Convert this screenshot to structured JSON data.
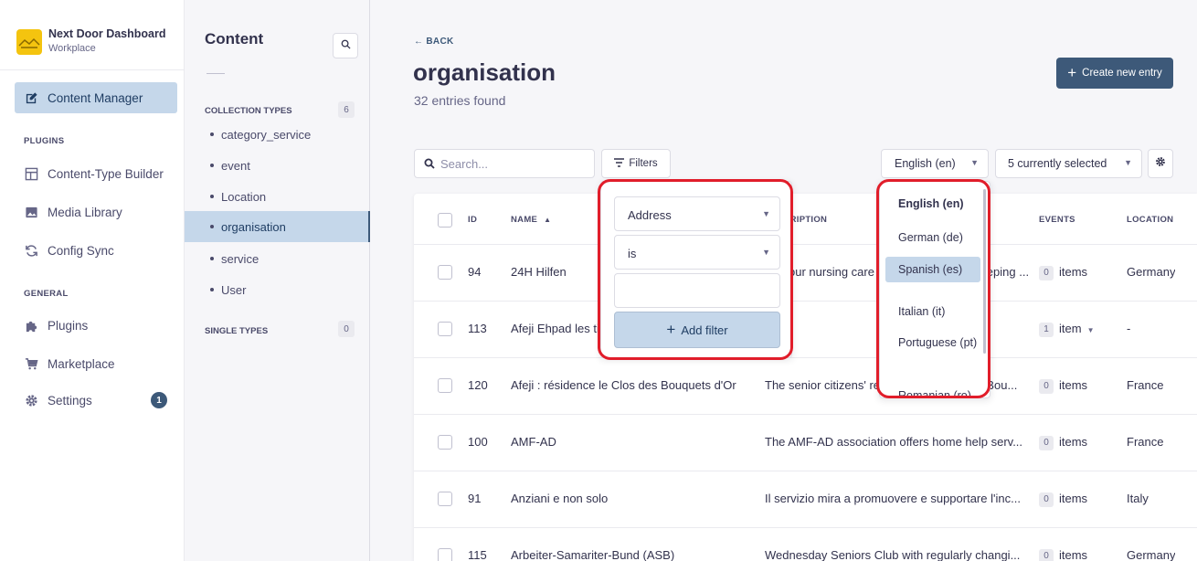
{
  "brand": {
    "title": "Next Door Dashboard",
    "subtitle": "Workplace"
  },
  "mainnav": {
    "content_manager": "Content Manager",
    "plugins_label": "PLUGINS",
    "ctb": "Content-Type Builder",
    "media": "Media Library",
    "config_sync": "Config Sync",
    "general_label": "GENERAL",
    "plugins": "Plugins",
    "marketplace": "Marketplace",
    "settings": "Settings",
    "settings_badge": "1"
  },
  "subnav": {
    "title": "Content",
    "collection_label": "COLLECTION TYPES",
    "collection_count": "6",
    "items": [
      "category_service",
      "event",
      "Location",
      "organisation",
      "service",
      "User"
    ],
    "single_label": "SINGLE TYPES",
    "single_count": "0"
  },
  "header": {
    "back": "BACK",
    "title": "organisation",
    "subtitle": "32 entries found",
    "create": "Create new entry"
  },
  "toolbar": {
    "search_placeholder": "Search...",
    "filters": "Filters",
    "locale": "English (en)",
    "columns": "5 currently selected"
  },
  "table": {
    "headers": {
      "id": "ID",
      "name": "NAME",
      "description": "DESCRIPTION",
      "events": "EVENTS",
      "location": "LOCATION"
    },
    "rows": [
      {
        "id": "94",
        "name": "24H Hilfen",
        "description": "24-hour nursing care service and housekeeping ...",
        "events_count": "0",
        "events_unit": "items",
        "location": "Germany"
      },
      {
        "id": "113",
        "name": "Afeji Ehpad les tilleuls",
        "description": "",
        "events_count": "1",
        "events_unit": "item",
        "location": "-"
      },
      {
        "id": "120",
        "name": "Afeji : résidence le Clos des Bouquets d'Or",
        "description": "The senior citizens' residence le Clos des Bou...",
        "events_count": "0",
        "events_unit": "items",
        "location": "France"
      },
      {
        "id": "100",
        "name": "AMF-AD",
        "description": "The AMF-AD association offers home help serv...",
        "events_count": "0",
        "events_unit": "items",
        "location": "France"
      },
      {
        "id": "91",
        "name": "Anziani e non solo",
        "description": "Il servizio mira a promuovere e supportare l'inc...",
        "events_count": "0",
        "events_unit": "items",
        "location": "Italy"
      },
      {
        "id": "115",
        "name": "Arbeiter-Samariter-Bund (ASB)",
        "description": "Wednesday Seniors Club with regularly changi...",
        "events_count": "0",
        "events_unit": "items",
        "location": "Germany"
      }
    ]
  },
  "filter_popover": {
    "field": "Address",
    "operator": "is",
    "value": "",
    "add": "Add filter"
  },
  "language_dropdown": {
    "options": [
      "English (en)",
      "German (de)",
      "Spanish (es)",
      "Italian (it)",
      "Portuguese (pt)",
      "Romanian (ro)"
    ],
    "selected": "English (en)",
    "hovered": "Spanish (es)"
  },
  "colors": {
    "primary": "#3d5979",
    "highlight": "#c5d7ea",
    "annotation": "#e11d2a"
  }
}
